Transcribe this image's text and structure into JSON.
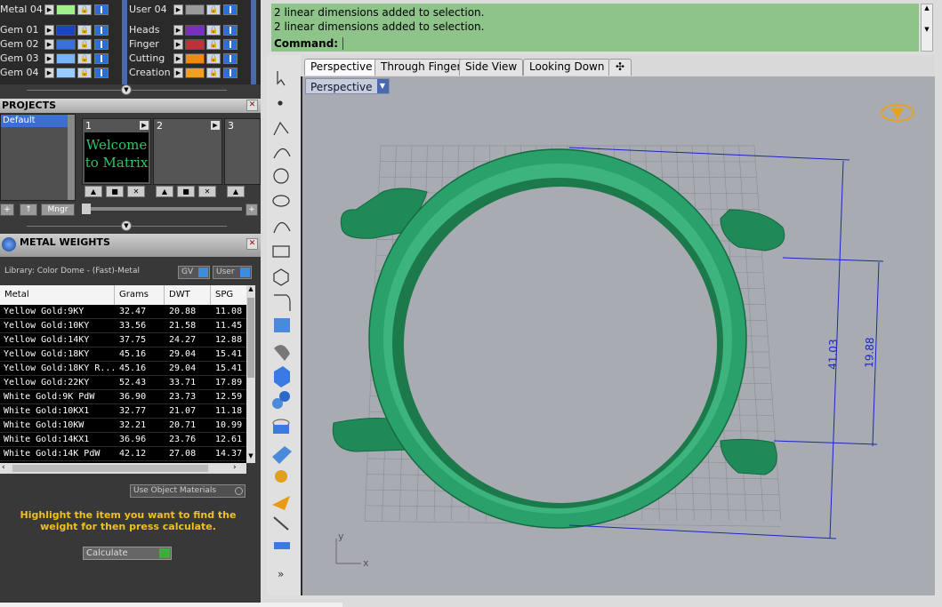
{
  "layers_left": [
    {
      "name": "Metal 04",
      "color": "#9ef08a"
    },
    {
      "name": "Gem 01",
      "color": "#1a44c8"
    },
    {
      "name": "Gem 02",
      "color": "#3a6fe0"
    },
    {
      "name": "Gem 03",
      "color": "#7ab4ff"
    },
    {
      "name": "Gem 04",
      "color": "#9acdff"
    }
  ],
  "layers_right": [
    {
      "name": "User 04",
      "color": "#9a9a9a"
    },
    {
      "name": "Heads",
      "color": "#7a2fc0"
    },
    {
      "name": "Finger",
      "color": "#c0303a"
    },
    {
      "name": "Cutting",
      "color": "#f08a10"
    },
    {
      "name": "Creation",
      "color": "#f0a020"
    }
  ],
  "projects": {
    "title": "PROJECTS",
    "list": [
      "Default"
    ],
    "slots": [
      "1",
      "2",
      "3"
    ],
    "thumb_text": "Welcome to Matrix",
    "mngr_label": "Mngr",
    "add_label": "+",
    "up_label": "↑"
  },
  "metal_weights": {
    "title": "METAL WEIGHTS",
    "library": "Library: Color Dome - (Fast)-Metal",
    "toggle_gv": "GV",
    "toggle_user": "User",
    "columns": [
      "Metal",
      "Grams",
      "DWT",
      "SPG"
    ],
    "rows": [
      [
        "Yellow Gold:9KY",
        "32.47",
        "20.88",
        "11.08"
      ],
      [
        "Yellow Gold:10KY",
        "33.56",
        "21.58",
        "11.45"
      ],
      [
        "Yellow Gold:14KY",
        "37.75",
        "24.27",
        "12.88"
      ],
      [
        "Yellow Gold:18KY",
        "45.16",
        "29.04",
        "15.41"
      ],
      [
        "Yellow Gold:18KY R...",
        "45.16",
        "29.04",
        "15.41"
      ],
      [
        "Yellow Gold:22KY",
        "52.43",
        "33.71",
        "17.89"
      ],
      [
        "White Gold:9K PdW",
        "36.90",
        "23.73",
        "12.59"
      ],
      [
        "White Gold:10KX1",
        "32.77",
        "21.07",
        "11.18"
      ],
      [
        "White Gold:10KW",
        "32.21",
        "20.71",
        "10.99"
      ],
      [
        "White Gold:14KX1",
        "36.96",
        "23.76",
        "12.61"
      ],
      [
        "White Gold:14K PdW",
        "42.12",
        "27.08",
        "14.37"
      ]
    ],
    "use_object_materials": "Use Object Materials",
    "hint": "Highlight the item you want to find the weight for then press calculate.",
    "calculate": "Calculate"
  },
  "command": {
    "log": [
      "2 linear dimensions added to selection.",
      "2 linear dimensions added to selection."
    ],
    "prompt": "Command:"
  },
  "tabs": [
    "Perspective",
    "Through Finger",
    "Side View",
    "Looking Down"
  ],
  "viewport": {
    "label": "Perspective",
    "dim_outer": "41.03",
    "dim_inner": "19.88",
    "axis_x": "x",
    "axis_y": "y",
    "model_color": "#2aa06a"
  }
}
